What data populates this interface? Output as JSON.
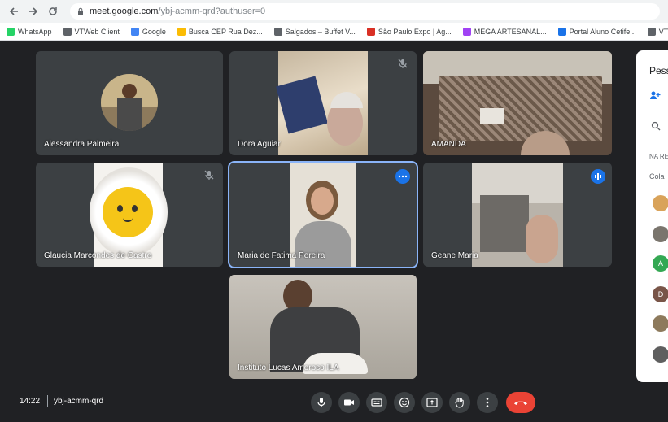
{
  "browser": {
    "back_icon": "arrow-left-icon",
    "forward_icon": "arrow-right-icon",
    "reload_icon": "reload-icon",
    "url_host": "meet.google.com",
    "url_path": "/ybj-acmm-qrd?authuser=0",
    "bookmarks": [
      {
        "label": "WhatsApp",
        "color": "#25d366"
      },
      {
        "label": "VTWeb Client",
        "color": "#5f6368"
      },
      {
        "label": "Google",
        "color": "#4285f4"
      },
      {
        "label": "Busca CEP Rua Dez...",
        "color": "#fbbc04"
      },
      {
        "label": "Salgados – Buffet V...",
        "color": "#5f6368"
      },
      {
        "label": "São Paulo Expo | Ag...",
        "color": "#d93025"
      },
      {
        "label": "MEGA ARTESANAL...",
        "color": "#a142f4"
      },
      {
        "label": "Portal Aluno Cetife...",
        "color": "#1a73e8"
      },
      {
        "label": "VTWeb Client",
        "color": "#5f6368"
      }
    ]
  },
  "participants": [
    {
      "name": "Alessandra Palmeira"
    },
    {
      "name": "Dora Aguiar"
    },
    {
      "name": "AMANDA"
    },
    {
      "name": "Glaucia Marcondes de Castro"
    },
    {
      "name": "Maria de Fatima Pereira"
    },
    {
      "name": "Geane Maria"
    },
    {
      "name": "Instituto Lucas Amoroso ILA"
    }
  ],
  "side_panel": {
    "title": "Pess",
    "section_label": "NA RE",
    "collab_label": "Cola",
    "avatar_letters": [
      "",
      "",
      "A",
      "D",
      "",
      ""
    ]
  },
  "bottom_bar": {
    "time": "14:22",
    "meeting_code": "ybj-acmm-qrd",
    "controls": [
      "mic-icon",
      "camera-icon",
      "captions-icon",
      "emoji-icon",
      "present-icon",
      "raise-hand-icon",
      "more-options-icon",
      "end-call-icon"
    ]
  }
}
